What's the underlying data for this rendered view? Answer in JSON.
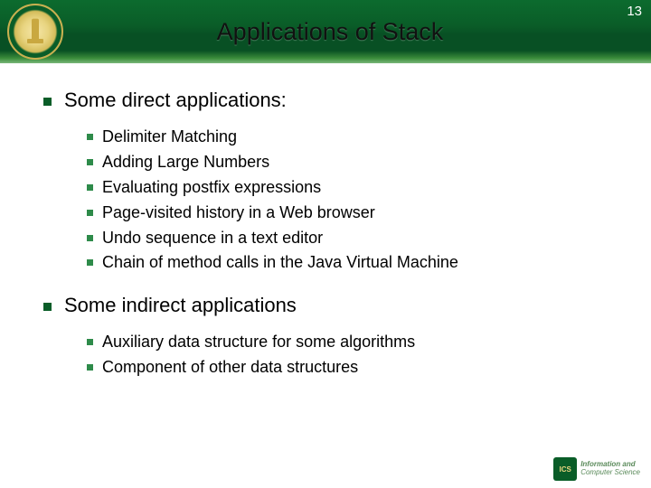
{
  "slide": {
    "title": "Applications of Stack",
    "page_number": "13"
  },
  "sections": [
    {
      "heading": "Some direct applications:",
      "items": [
        "Delimiter Matching",
        "Adding Large Numbers",
        "Evaluating postfix expressions",
        "Page-visited history in a Web browser",
        "Undo sequence in a text editor",
        "Chain of method calls in the Java Virtual Machine"
      ]
    },
    {
      "heading": "Some indirect applications",
      "items": [
        "Auxiliary data structure for some algorithms",
        "Component of other data structures"
      ]
    }
  ],
  "footer": {
    "badge": "ICS",
    "line1": "Information and",
    "line2": "Computer Science"
  }
}
